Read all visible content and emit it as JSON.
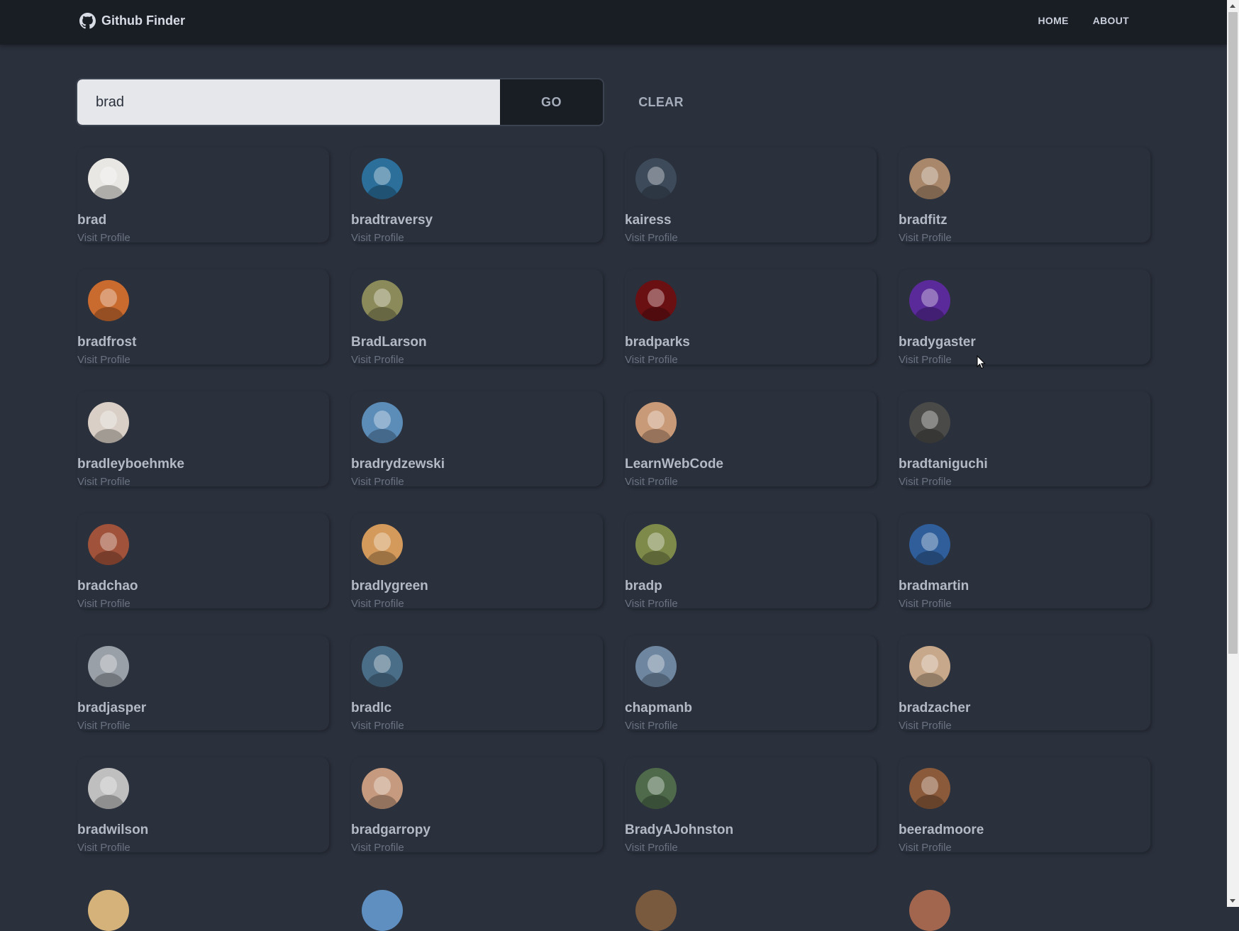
{
  "brand": {
    "title": "Github Finder",
    "icon": "github-icon"
  },
  "nav": {
    "home": "HOME",
    "about": "ABOUT"
  },
  "search": {
    "value": "brad",
    "placeholder": "",
    "go_label": "GO",
    "clear_label": "CLEAR"
  },
  "colors": {
    "navbar_bg": "#191d24",
    "page_bg": "#2a303c",
    "input_bg": "#e6e7ea",
    "text": "#a6adbb",
    "muted": "#6a7281"
  },
  "users": [
    {
      "login": "brad",
      "link": "Visit Profile",
      "avatar_color": "#e9e7e3"
    },
    {
      "login": "bradtraversy",
      "link": "Visit Profile",
      "avatar_color": "#2b6f9a"
    },
    {
      "login": "kairess",
      "link": "Visit Profile",
      "avatar_color": "#3c4a5a"
    },
    {
      "login": "bradfitz",
      "link": "Visit Profile",
      "avatar_color": "#a8876b"
    },
    {
      "login": "bradfrost",
      "link": "Visit Profile",
      "avatar_color": "#c96a2e"
    },
    {
      "login": "BradLarson",
      "link": "Visit Profile",
      "avatar_color": "#8a8a5a"
    },
    {
      "login": "bradparks",
      "link": "Visit Profile",
      "avatar_color": "#6a0f12"
    },
    {
      "login": "bradygaster",
      "link": "Visit Profile",
      "avatar_color": "#5a2a9a"
    },
    {
      "login": "bradleyboehmke",
      "link": "Visit Profile",
      "avatar_color": "#d9cfc6"
    },
    {
      "login": "bradrydzewski",
      "link": "Visit Profile",
      "avatar_color": "#5c8db8"
    },
    {
      "login": "LearnWebCode",
      "link": "Visit Profile",
      "avatar_color": "#c99a78"
    },
    {
      "login": "bradtaniguchi",
      "link": "Visit Profile",
      "avatar_color": "#4a4a48"
    },
    {
      "login": "bradchao",
      "link": "Visit Profile",
      "avatar_color": "#a0523a"
    },
    {
      "login": "bradlygreen",
      "link": "Visit Profile",
      "avatar_color": "#d39a5b"
    },
    {
      "login": "bradp",
      "link": "Visit Profile",
      "avatar_color": "#7d8a4a"
    },
    {
      "login": "bradmartin",
      "link": "Visit Profile",
      "avatar_color": "#2f5e9a"
    },
    {
      "login": "bradjasper",
      "link": "Visit Profile",
      "avatar_color": "#9aa0a8"
    },
    {
      "login": "bradlc",
      "link": "Visit Profile",
      "avatar_color": "#4a6e88"
    },
    {
      "login": "chapmanb",
      "link": "Visit Profile",
      "avatar_color": "#6e86a0"
    },
    {
      "login": "bradzacher",
      "link": "Visit Profile",
      "avatar_color": "#c7a88a"
    },
    {
      "login": "bradwilson",
      "link": "Visit Profile",
      "avatar_color": "#bfbfbf"
    },
    {
      "login": "bradgarropy",
      "link": "Visit Profile",
      "avatar_color": "#c59a7e"
    },
    {
      "login": "BradyAJohnston",
      "link": "Visit Profile",
      "avatar_color": "#4e6a4a"
    },
    {
      "login": "beeradmoore",
      "link": "Visit Profile",
      "avatar_color": "#8a5a3a"
    }
  ],
  "partial_avatars": [
    {
      "avatar_color": "#d4b27a"
    },
    {
      "avatar_color": "#5f8fc0"
    },
    {
      "avatar_color": "#7a5a3e"
    },
    {
      "avatar_color": "#a2664e"
    }
  ]
}
